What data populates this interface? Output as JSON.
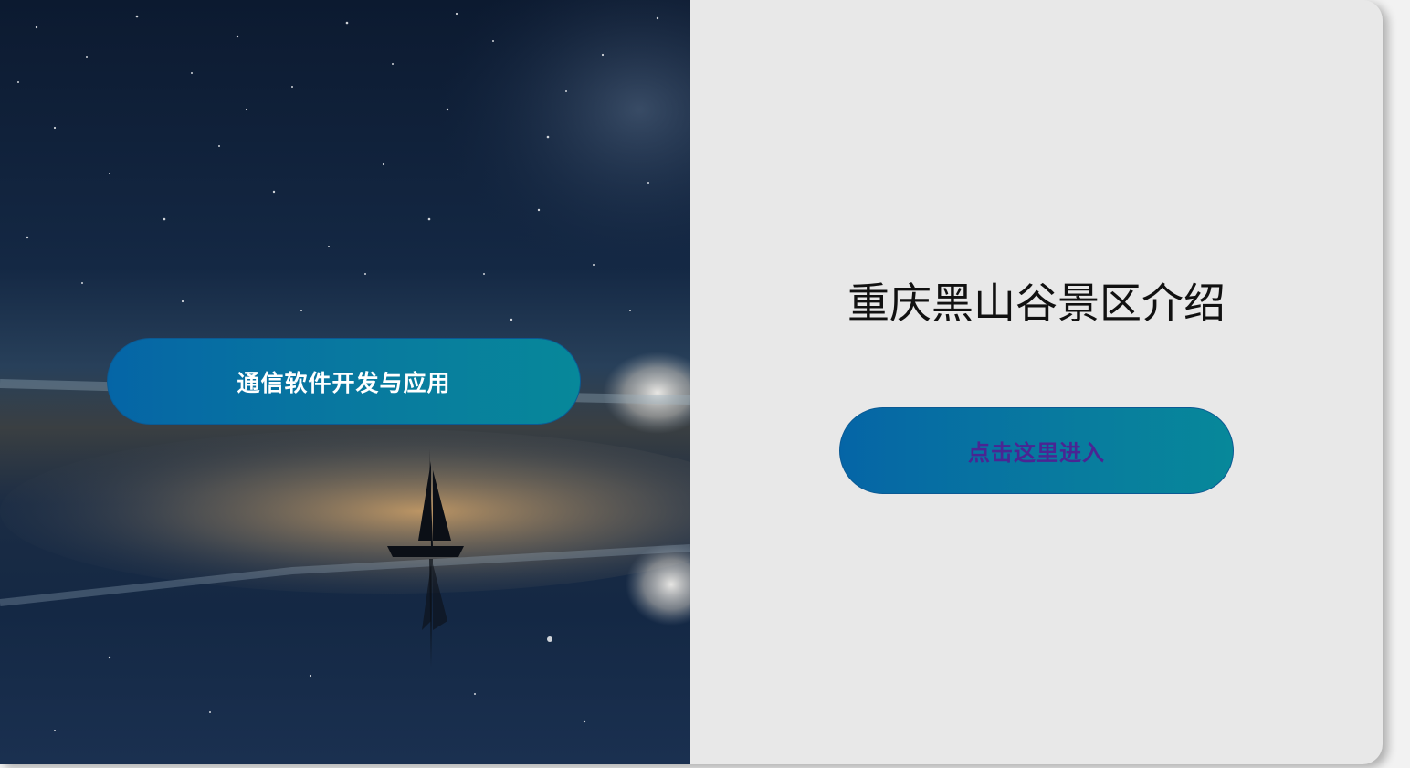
{
  "hero": {
    "course_button_label": "通信软件开发与应用",
    "image": "night-sky-sailboat-image"
  },
  "panel": {
    "title": "重庆黑山谷景区介绍",
    "enter_button_label": "点击这里进入"
  },
  "colors": {
    "button_gradient_start": "#0565a6",
    "button_gradient_end": "#07889a",
    "course_label_color": "#ffffff",
    "enter_label_color": "#4a2593",
    "panel_background": "#e8e8e8"
  }
}
